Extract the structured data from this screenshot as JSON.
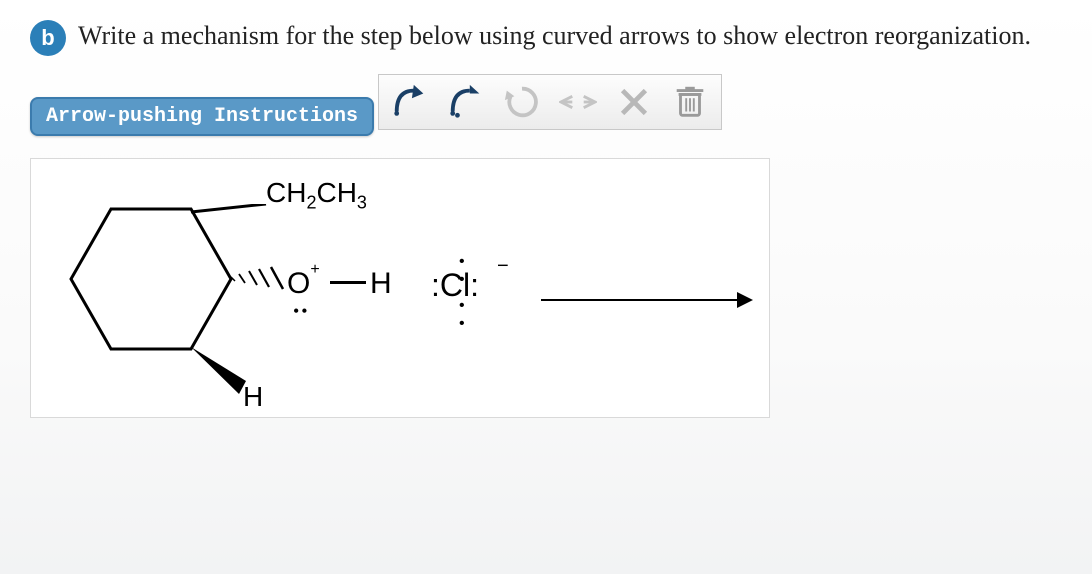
{
  "badge": "b",
  "prompt": "Write a mechanism for the step below using curved arrows to show electron reorganization.",
  "instructions_button": "Arrow-pushing Instructions",
  "toolbar": {
    "arrow_full": "curved-arrow-full",
    "arrow_half": "curved-arrow-half",
    "rotate": "rotate",
    "hflip": "horizontal-flip",
    "delete": "delete",
    "clear": "clear-all"
  },
  "molecule": {
    "substituent_top": "CH2CH3",
    "oxonium_label_O": "O",
    "oxonium_label_H": "H",
    "oxonium_charge": "+",
    "wedge_bottom_label": "H",
    "nucleophile": ":Cl:"
  }
}
